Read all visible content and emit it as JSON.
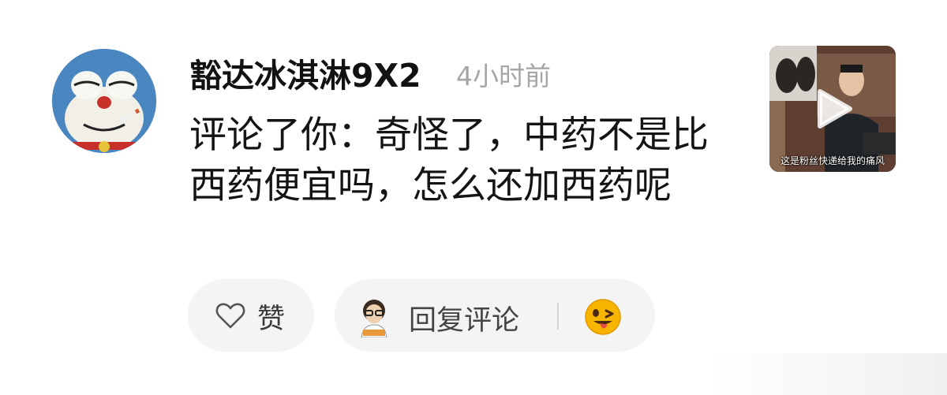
{
  "comment": {
    "username": "豁达冰淇淋9X2",
    "time": "4小时前",
    "text": "评论了你：奇怪了，中药不是比西药便宜吗，怎么还加西药呢",
    "avatar_icon": "doraemon-smoking-avatar"
  },
  "thumbnail": {
    "caption": "这是粉丝快递给我的痛风",
    "icon": "play-icon"
  },
  "actions": {
    "like_label": "赞",
    "like_icon": "heart-outline-icon",
    "reply_label": "回复评论",
    "reply_avatar_icon": "cartoon-user-avatar",
    "emoji_icon": "winking-tongue-emoji"
  },
  "colors": {
    "username": "#121212",
    "time": "#a6a6a6",
    "pill_bg": "#f4f4f4",
    "emoji": "#f7b500"
  }
}
